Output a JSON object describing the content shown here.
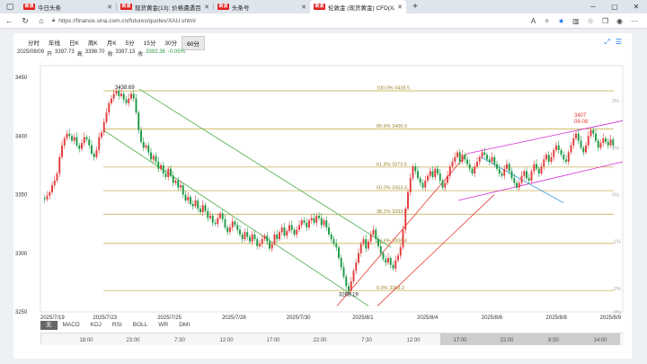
{
  "browser": {
    "tabs": [
      {
        "favicon": "新浪",
        "title": "今日头条",
        "active": false
      },
      {
        "favicon": "新浪",
        "title": "现货黄金(13): 价格遭遇百年?",
        "active": false
      },
      {
        "favicon": "新浪",
        "title": "头条号",
        "active": false
      },
      {
        "favicon": "新浪",
        "title": "伦敦金 (现货黄金) CFD(XAU)实",
        "active": true
      }
    ],
    "url": "https://finance.sina.com.cn/futures/quotes/XAU.shtml"
  },
  "chart": {
    "periods": [
      "分时",
      "年线",
      "日K",
      "周K",
      "月K",
      "5分",
      "15分",
      "30分",
      "60分"
    ],
    "active_period": "60分",
    "ohlc": {
      "date": "2025/08/09",
      "open_label": "开",
      "open": "3397.73",
      "high_label": "高",
      "high": "3398.70",
      "low_label": "收",
      "low": "3397.13",
      "close_label": "收",
      "close": "3392.36",
      "change": "-0.05%"
    },
    "indicators": [
      "无",
      "MACD",
      "KDJ",
      "RSI",
      "BOLL",
      "WR",
      "DMI"
    ],
    "active_indicator": "无",
    "nav_time_labels": [
      "18:00",
      "23:00",
      "7:30",
      "12:00",
      "17:00",
      "22:00",
      "7:30",
      "12:00",
      "17:00",
      "22:00",
      "8:30",
      "14:00"
    ]
  },
  "chart_data": {
    "type": "candlestick",
    "ylim": [
      3250,
      3460
    ],
    "yticks": [
      3250,
      3300,
      3350,
      3400,
      3450
    ],
    "right_percent_labels": [
      "3%",
      "1%",
      "0%",
      "-1%",
      "-2%",
      "-3%"
    ],
    "x_labels": [
      "2025/7/19",
      "2025/7/23",
      "2025/7/25",
      "2025/7/28",
      "2025/7/30",
      "2025/8/1",
      "2025/8/4",
      "2025/8/6",
      "2025/8/8",
      "2025/8/9"
    ],
    "fibonacci_levels": [
      {
        "label": "100.0% 3438.5",
        "value": 3438.5
      },
      {
        "label": "80.9% 3406.0",
        "value": 3406.0
      },
      {
        "label": "61.8% 3373.5",
        "value": 3373.5
      },
      {
        "label": "50.0% 3353.4",
        "value": 3353.4
      },
      {
        "label": "38.2% 3333.3",
        "value": 3333.3
      },
      {
        "label": "23.6% 3308.4",
        "value": 3308.4
      },
      {
        "label": "0.0% 3268.2",
        "value": 3268.2
      }
    ],
    "annotations": [
      {
        "text": "3438.69",
        "value": 3438.69
      },
      {
        "text": "3268.19",
        "value": 3268.19
      },
      {
        "text": "3407",
        "value": 3407
      },
      {
        "text": "08-08",
        "value": null
      }
    ],
    "price_path": [
      3347,
      3346,
      3349,
      3352,
      3358,
      3362,
      3368,
      3382,
      3392,
      3398,
      3402,
      3400,
      3396,
      3399,
      3392,
      3389,
      3394,
      3399,
      3397,
      3392,
      3385,
      3382,
      3388,
      3399,
      3403,
      3412,
      3420,
      3428,
      3432,
      3436,
      3438.5,
      3434,
      3436,
      3431,
      3428,
      3432,
      3436,
      3432,
      3420,
      3405,
      3395,
      3390,
      3392,
      3386,
      3380,
      3383,
      3378,
      3372,
      3375,
      3368,
      3365,
      3372,
      3366,
      3360,
      3362,
      3356,
      3358,
      3350,
      3345,
      3348,
      3342,
      3340,
      3345,
      3338,
      3335,
      3341,
      3336,
      3330,
      3332,
      3326,
      3325,
      3330,
      3334,
      3329,
      3322,
      3318,
      3322,
      3327,
      3324,
      3320,
      3316,
      3312,
      3318,
      3314,
      3310,
      3316,
      3312,
      3306,
      3308,
      3312,
      3315,
      3310,
      3304,
      3308,
      3316,
      3312,
      3318,
      3322,
      3315,
      3319,
      3324,
      3320,
      3316,
      3320,
      3324,
      3328,
      3326,
      3322,
      3328,
      3330,
      3326,
      3332,
      3330,
      3324,
      3328,
      3322,
      3316,
      3312,
      3308,
      3305,
      3296,
      3288,
      3280,
      3272,
      3268.2,
      3276,
      3285,
      3292,
      3300,
      3308,
      3312,
      3304,
      3310,
      3316,
      3320,
      3312,
      3306,
      3300,
      3295,
      3292,
      3296,
      3290,
      3287,
      3294,
      3298,
      3305,
      3320,
      3338,
      3352,
      3364,
      3374,
      3370,
      3364,
      3360,
      3356,
      3362,
      3366,
      3370,
      3365,
      3372,
      3368,
      3362,
      3356,
      3360,
      3366,
      3374,
      3378,
      3382,
      3386,
      3378,
      3384,
      3380,
      3376,
      3372,
      3368,
      3374,
      3378,
      3382,
      3386,
      3384,
      3380,
      3378,
      3382,
      3376,
      3372,
      3368,
      3366,
      3372,
      3376,
      3370,
      3364,
      3360,
      3356,
      3360,
      3366,
      3370,
      3364,
      3362,
      3370,
      3376,
      3372,
      3368,
      3374,
      3380,
      3384,
      3378,
      3382,
      3388,
      3392,
      3388,
      3384,
      3380,
      3378,
      3386,
      3392,
      3398,
      3402,
      3396,
      3390,
      3386,
      3392,
      3400,
      3405,
      3402,
      3396,
      3390,
      3394,
      3398,
      3395,
      3392,
      3397,
      3392
    ]
  }
}
